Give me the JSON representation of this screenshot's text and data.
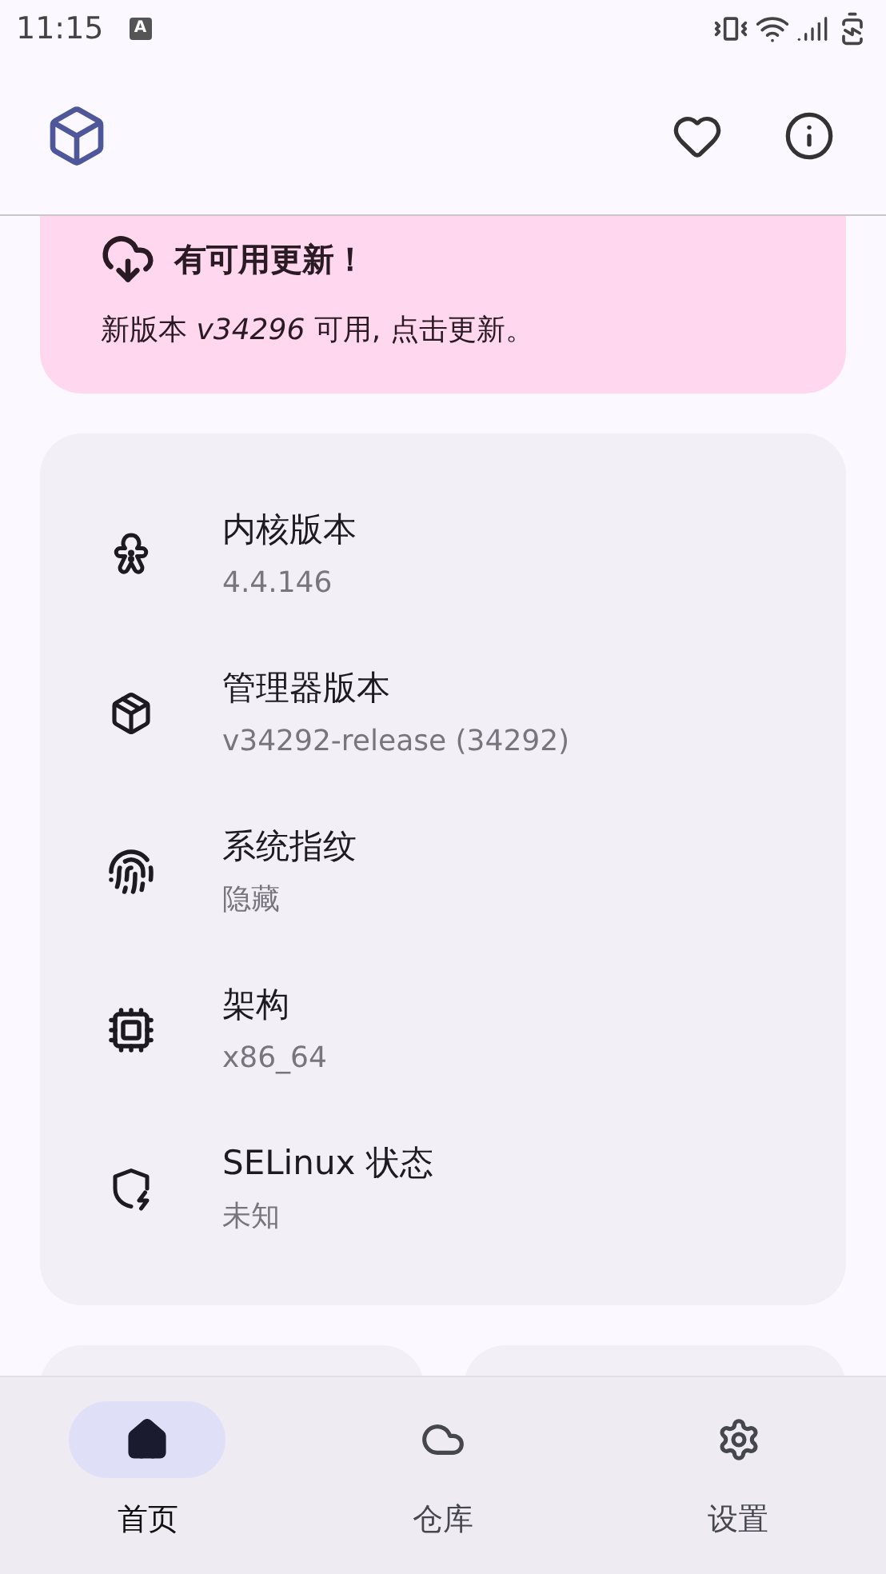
{
  "status_bar": {
    "time": "11:15",
    "notification": "A"
  },
  "update_card": {
    "title": "有可用更新！",
    "message": "新版本 *v34296* 可用, 点击更新。"
  },
  "info_items": [
    {
      "title": "内核版本",
      "value": "4.4.146"
    },
    {
      "title": "管理器版本",
      "value": "v34292-release (34292)"
    },
    {
      "title": "系统指纹",
      "value": "隐藏"
    },
    {
      "title": "架构",
      "value": "x86_64"
    },
    {
      "title": "SELinux 状态",
      "value": "未知"
    }
  ],
  "nav_items": [
    {
      "label": "首页",
      "selected": true
    },
    {
      "label": "仓库",
      "selected": false
    },
    {
      "label": "设置",
      "selected": false
    }
  ]
}
